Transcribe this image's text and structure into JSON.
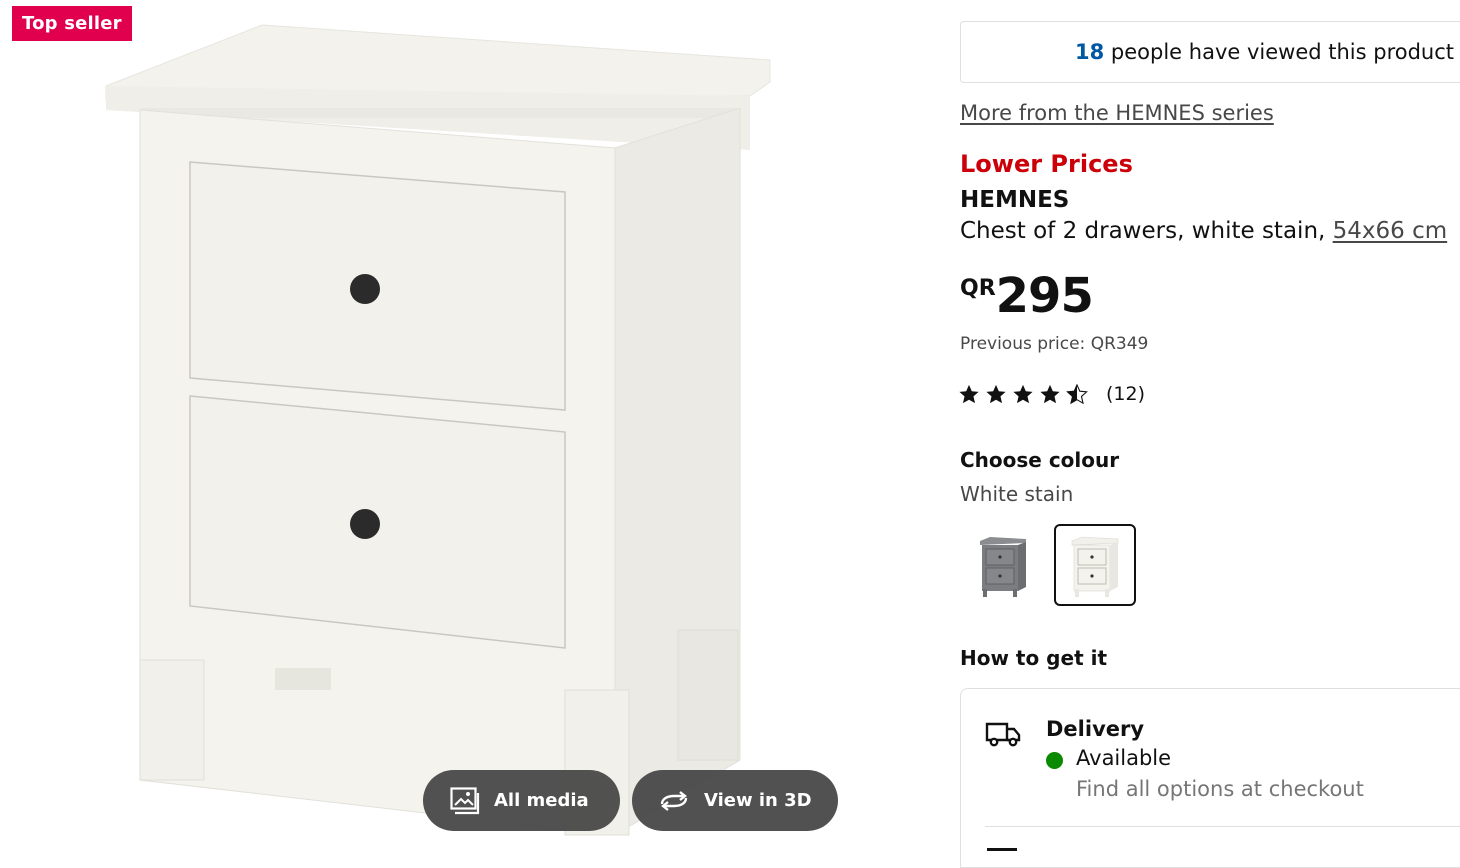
{
  "gallery": {
    "badge": "Top seller",
    "all_media_label": "All media",
    "view_3d_label": "View in 3D"
  },
  "product": {
    "viewed_count": "18",
    "viewed_text": " people have viewed this product tod",
    "series_link": "More from the HEMNES series",
    "promo": "Lower Prices",
    "name": "HEMNES",
    "description": "Chest of 2 drawers, white stain, ",
    "size_link": "54x66 cm",
    "currency": "QR",
    "price": "295",
    "previous_price": "Previous price: QR349",
    "rating_count": "(12)",
    "rating_value": 4.5
  },
  "colour": {
    "heading": "Choose colour",
    "selected": "White stain",
    "options": [
      "grey",
      "white-stain"
    ]
  },
  "delivery": {
    "heading": "How to get it",
    "title": "Delivery",
    "status": "Available",
    "note": "Find all options at checkout"
  },
  "colors": {
    "badge": "#e0004d",
    "promo": "#cc0008",
    "link_blue": "#0058a3",
    "available": "#0a8a00"
  }
}
